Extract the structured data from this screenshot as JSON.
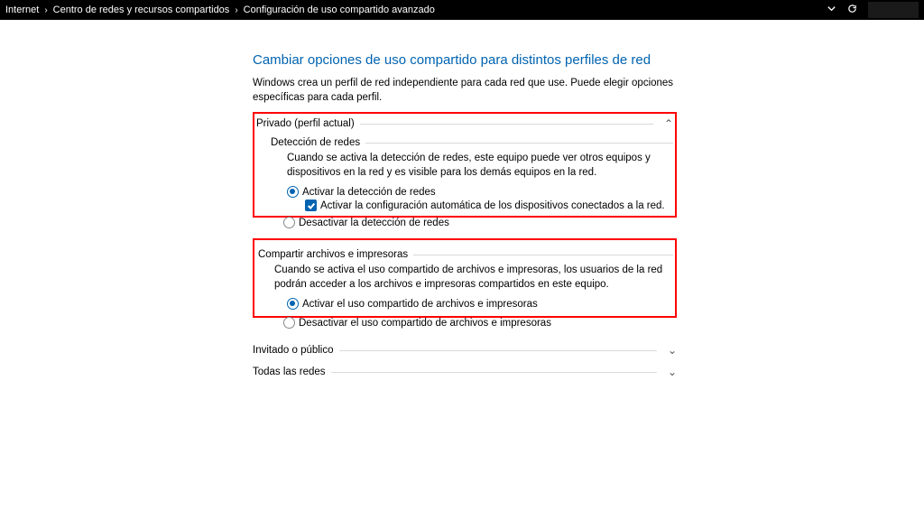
{
  "breadcrumbs": [
    "Internet",
    "Centro de redes y recursos compartidos",
    "Configuración de uso compartido avanzado"
  ],
  "heading": "Cambiar opciones de uso compartido para distintos perfiles de red",
  "intro": "Windows crea un perfil de red independiente para cada red que use. Puede elegir opciones específicas para cada perfil.",
  "private": {
    "title": "Privado (perfil actual)",
    "discovery": {
      "title": "Detección de redes",
      "desc": "Cuando se activa la detección de redes, este equipo puede ver otros equipos y dispositivos en la red y es visible para los demás equipos en la red.",
      "optOn": "Activar la detección de redes",
      "autoCfg": "Activar la configuración automática de los dispositivos conectados a la red.",
      "optOff": "Desactivar la detección de redes"
    },
    "sharing": {
      "title": "Compartir archivos e impresoras",
      "desc": "Cuando se activa el uso compartido de archivos e impresoras, los usuarios de la red podrán acceder a los archivos e impresoras compartidos en este equipo.",
      "optOn": "Activar el uso compartido de archivos e impresoras",
      "optOff": "Desactivar el uso compartido de archivos e impresoras"
    }
  },
  "guest": {
    "title": "Invitado o público"
  },
  "all": {
    "title": "Todas las redes"
  }
}
